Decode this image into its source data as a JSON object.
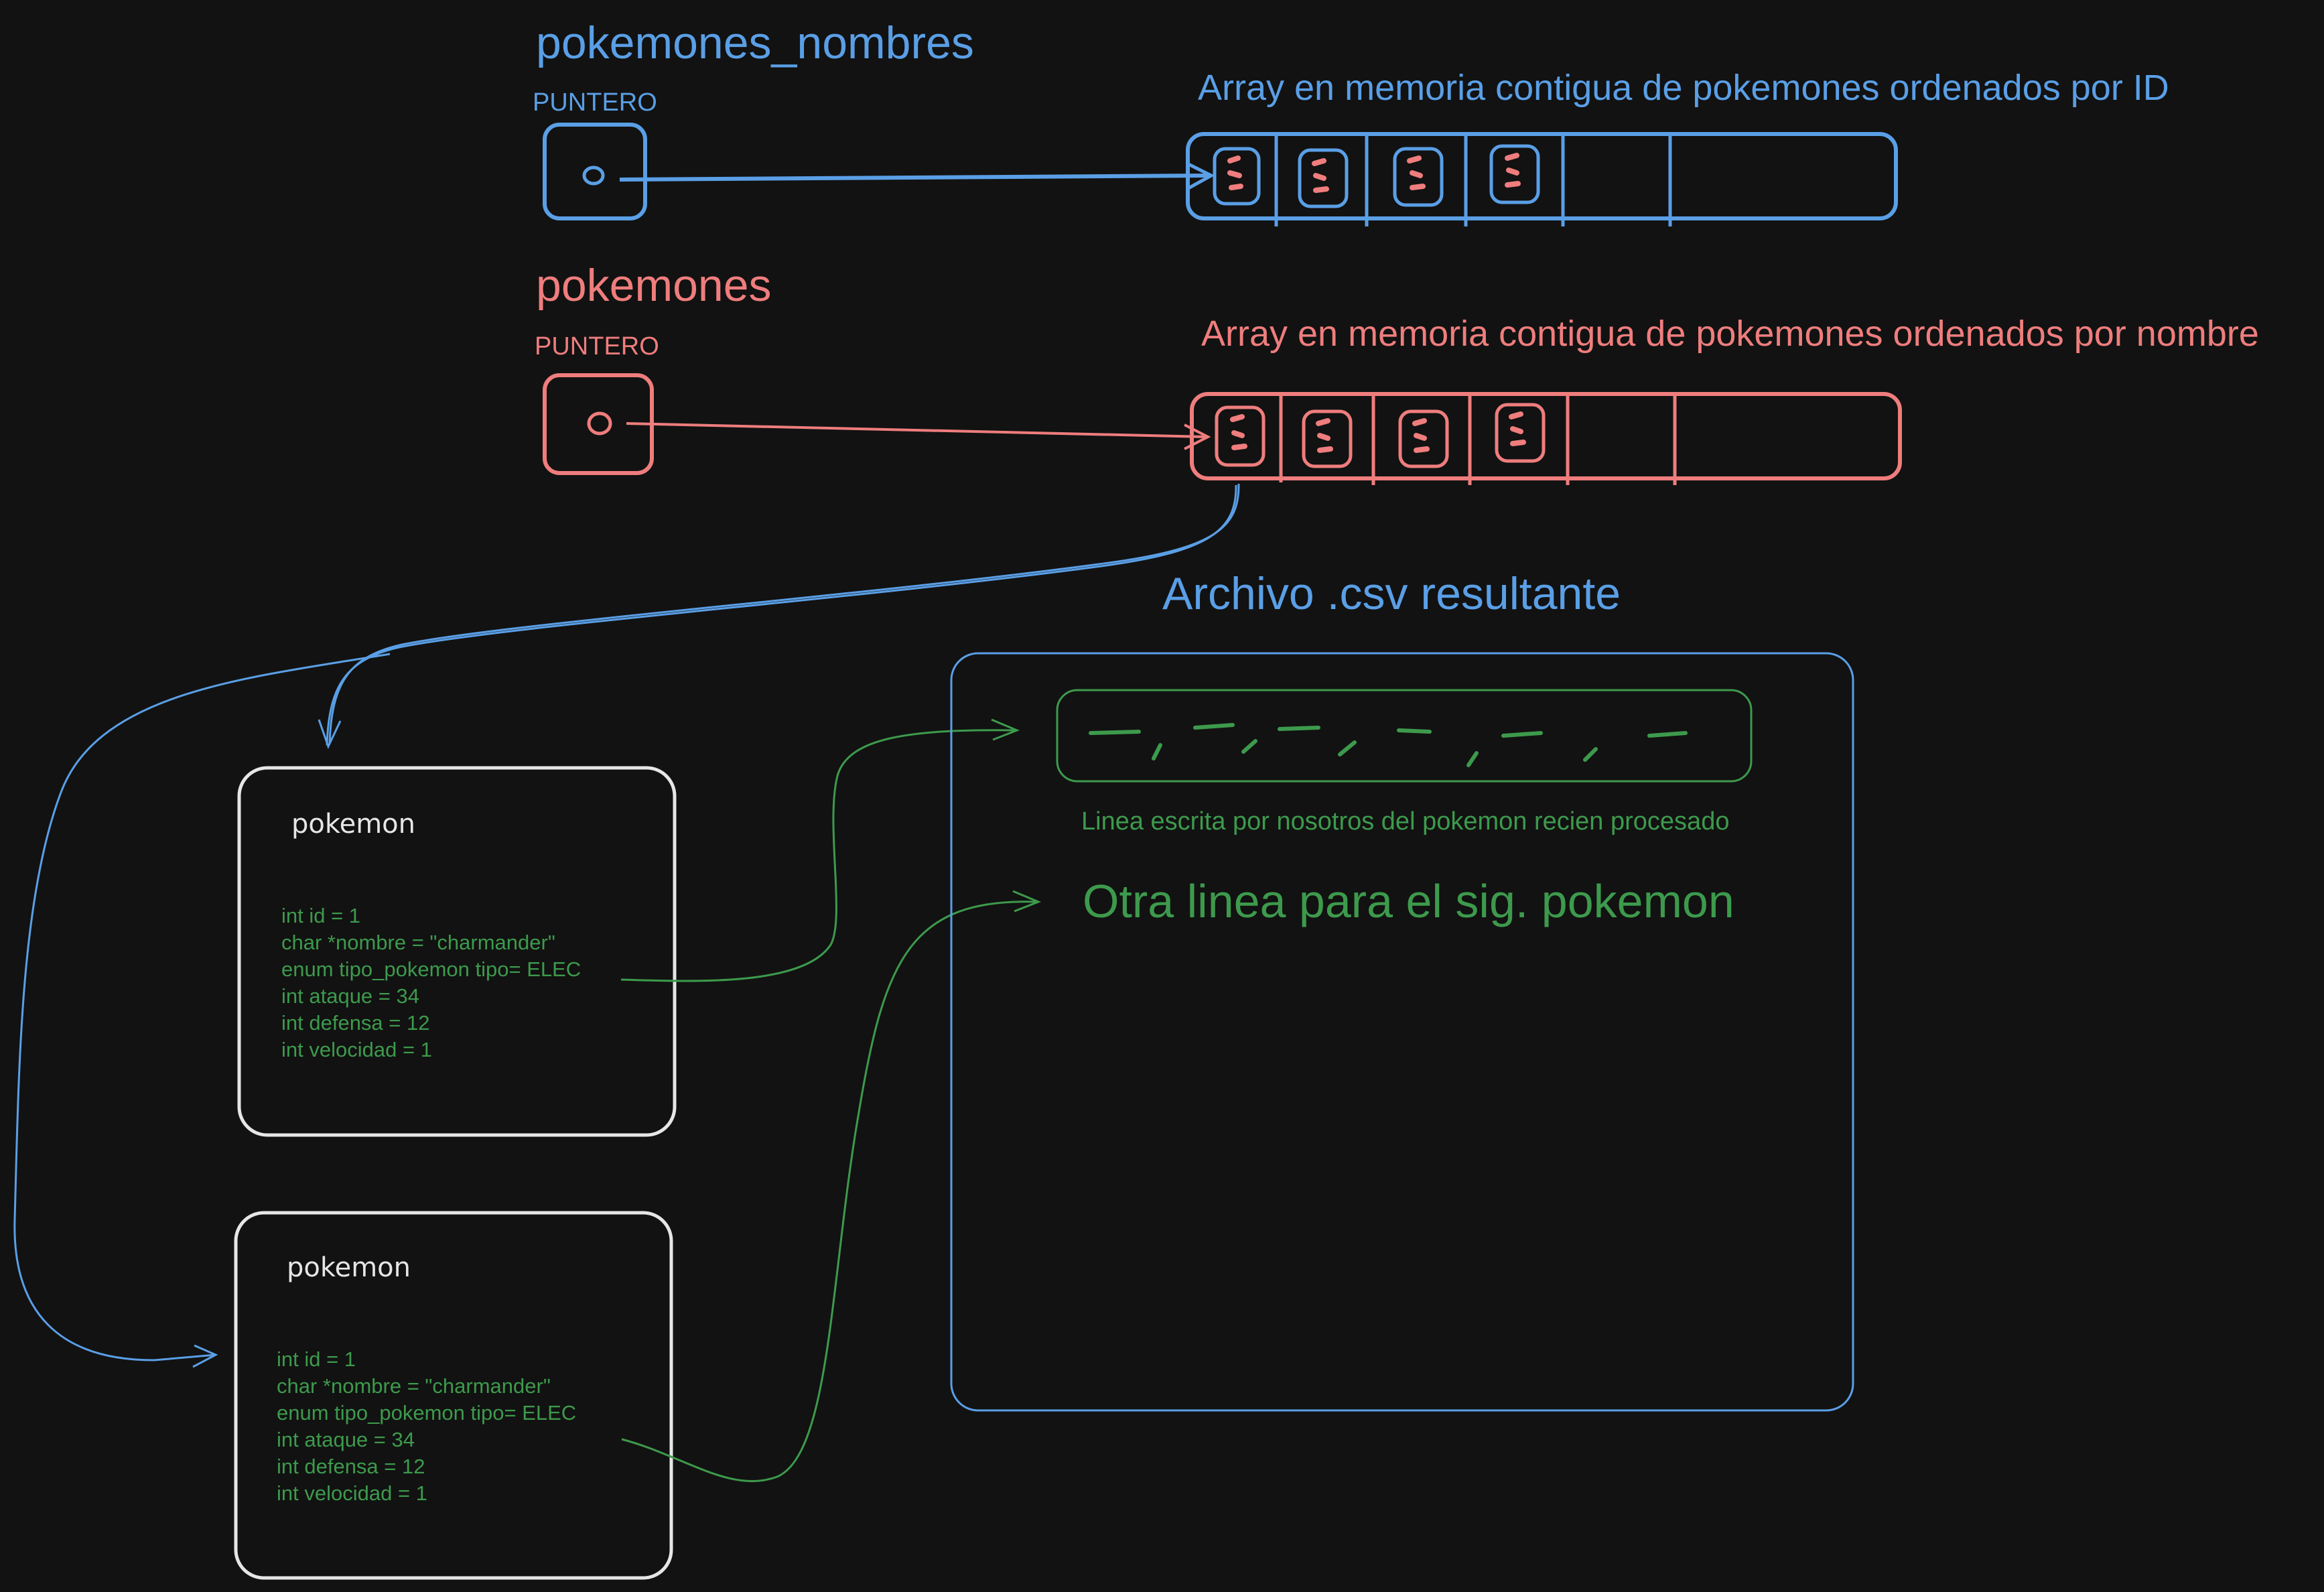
{
  "pointers": [
    {
      "name": "pokemones_nombres",
      "type_label": "PUNTERO",
      "color": "#5a9fe6"
    },
    {
      "name": "pokemones",
      "type_label": "PUNTERO",
      "color": "#ef7d7d"
    }
  ],
  "arrays": [
    {
      "caption": "Array en memoria contigua de pokemones ordenados por ID",
      "color": "#5a9fe6"
    },
    {
      "caption": "Array en memoria contigua de pokemones ordenados por nombre",
      "color": "#ef7d7d"
    }
  ],
  "csv": {
    "title": "Archivo .csv resultante",
    "line_note": "Linea escrita por nosotros del pokemon recien procesado",
    "next_line": "Otra linea para el sig. pokemon",
    "color": "#3d9a4c"
  },
  "cards": [
    {
      "title": "pokemon",
      "fields": [
        "int id = 1",
        "char *nombre = \"charmander\"",
        "enum tipo_pokemon tipo= ELEC",
        "int ataque = 34",
        "int defensa = 12",
        "int velocidad = 1"
      ]
    },
    {
      "title": "pokemon",
      "fields": [
        "int id = 1",
        "char *nombre = \"charmander\"",
        "enum tipo_pokemon tipo= ELEC",
        "int ataque = 34",
        "int defensa = 12",
        "int velocidad = 1"
      ]
    }
  ],
  "colors": {
    "background": "#121212",
    "blue": "#5a9fe6",
    "red": "#ef7d7d",
    "green": "#3d9a4c",
    "card_border": "#e6e6e6"
  }
}
